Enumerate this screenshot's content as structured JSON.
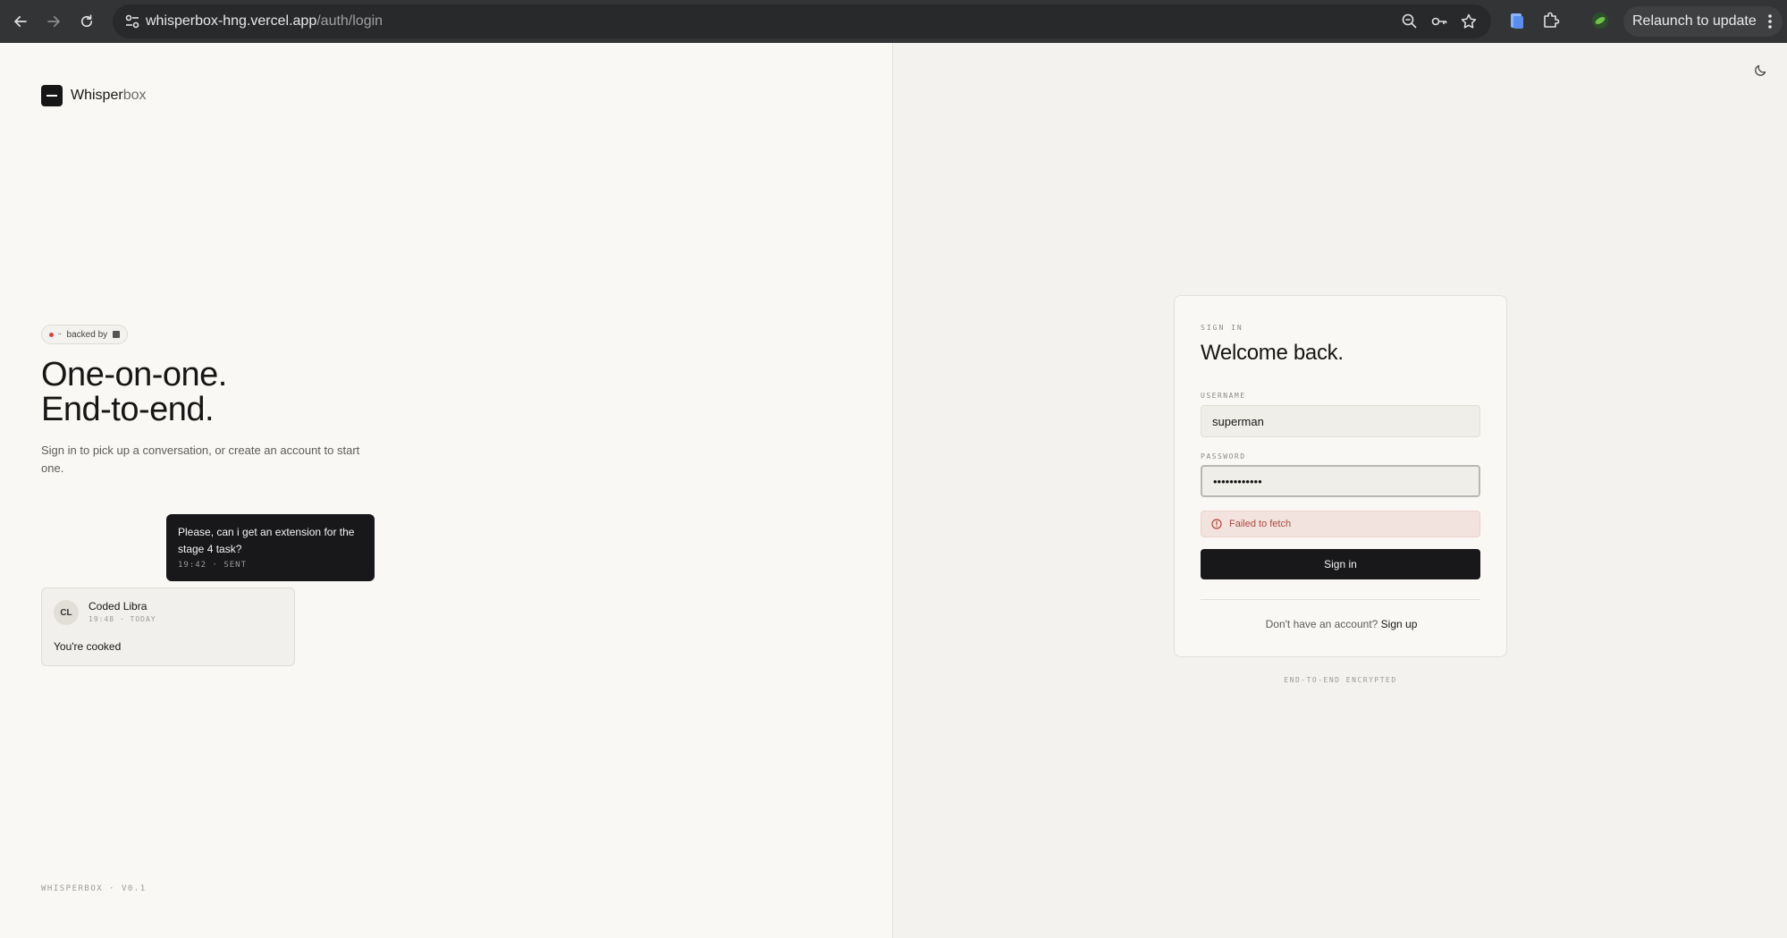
{
  "browser": {
    "url_host": "whisperbox-hng.vercel.app",
    "url_path": "/auth/login",
    "relaunch_label": "Relaunch to update"
  },
  "brand": {
    "name_main": "Whisper",
    "name_light": "box"
  },
  "hero": {
    "badge_label": "backed by",
    "headline_line1": "One-on-one.",
    "headline_line2": "End-to-end.",
    "subtitle": "Sign in to pick up a conversation, or create an account to start one."
  },
  "preview": {
    "sent_message": "Please, can i get an extension for the stage 4 task?",
    "sent_meta": "19:42 · SENT",
    "received_initials": "CL",
    "received_name": "Coded Libra",
    "received_meta": "19:48 · TODAY",
    "received_message": "You're cooked"
  },
  "footer": {
    "version": "WHISPERBOX · V0.1"
  },
  "login": {
    "eyebrow": "SIGN IN",
    "title": "Welcome back.",
    "username_label": "USERNAME",
    "username_value": "superman",
    "password_label": "PASSWORD",
    "password_value": "••••••••••••",
    "error": "Failed to fetch",
    "submit_label": "Sign in",
    "signup_prompt": "Don't have an account?",
    "signup_link": "Sign up",
    "security_note": "END-TO-END ENCRYPTED"
  },
  "colors": {
    "accent_dark": "#18181b",
    "error_text": "#b0473b",
    "error_bg": "#f2e3df",
    "page_bg_left": "#f9f8f4",
    "page_bg_right": "#f3f2ee"
  }
}
